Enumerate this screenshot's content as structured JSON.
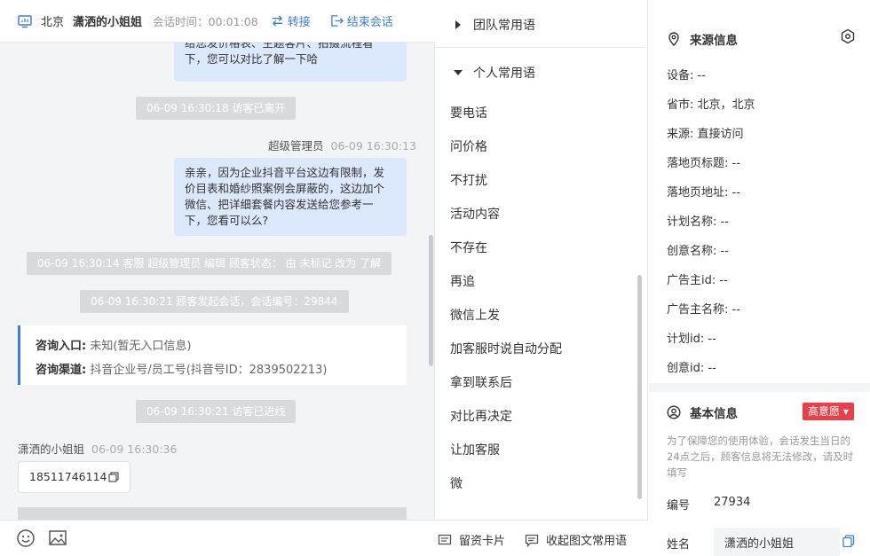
{
  "header": {
    "city": "北京",
    "visitor_name": "潇洒的小姐姐",
    "session_time_label": "会话时间：",
    "session_time": "00:01:08",
    "transfer_label": "转接",
    "end_label": "结束会话"
  },
  "messages": {
    "msg1_line1": "给您发价格表、主题客片、拍摄流程看",
    "msg1_line2": "下，您可以对比了解一下哈",
    "sys_left": "06-09 16:30:18 访客已离开",
    "agent_name": "超级管理员",
    "agent_time": "06-09 16:30:13",
    "msg2_line1": "亲亲，因为企业抖音平台这边有限制，发",
    "msg2_line2": "价目表和婚纱照案例会屏蔽的，这边加个",
    "msg2_line3": "微信、把详细套餐内容发送给您参考一",
    "msg2_line4": "下，您看可以么?",
    "sys_status": "06-09 16:30:14 客服 超级管理员 编辑 顾客状态： 由 未标记 改为 了解",
    "sys_start": "06-09 16:30:21 顾客发起会话，会话编号：29844",
    "entry_label": "咨询入口:",
    "entry_value": "未知(暂无入口信息)",
    "channel_label": "咨询渠道:",
    "channel_value": "抖音企业号/员工号(抖音号ID：2839502213)",
    "sys_online": "06-09 16:30:21 访客已进线",
    "visitor_name": "潇洒的小姐姐",
    "visitor_time": "06-09 16:30:36",
    "phone": "18511746114"
  },
  "phrases": {
    "team_label": "团队常用语",
    "personal_label": "个人常用语",
    "items": [
      "要电话",
      "问价格",
      "不打扰",
      "活动内容",
      "不存在",
      "再追",
      "微信上发",
      "加客服时说自动分配",
      "拿到联系后",
      "对比再决定",
      "让加客服",
      "微"
    ],
    "card_label": "留资卡片",
    "collapse_label": "收起图文常用语"
  },
  "source": {
    "title": "来源信息",
    "rows": [
      "设备: --",
      "省市: 北京，北京",
      "来源: 直接访问",
      "落地页标题: --",
      "落地页地址: --",
      "计划名称: --",
      "创意名称: --",
      "广告主id: --",
      "广告主名称: --",
      "计划id: --",
      "创意id: --"
    ]
  },
  "basic": {
    "title": "基本信息",
    "badge": "高意愿 ▾",
    "notice": "为了保障您的使用体验，会话发生当日的24点之后，顾客信息将无法修改，请及时填写",
    "id_label": "编号",
    "id_value": "27934",
    "name_label": "姓名",
    "name_value": "潇洒的小姐姐"
  },
  "colors": {
    "accent": "#3a7ee8",
    "bubble": "#dce9fc",
    "badge": "#e8404a"
  }
}
